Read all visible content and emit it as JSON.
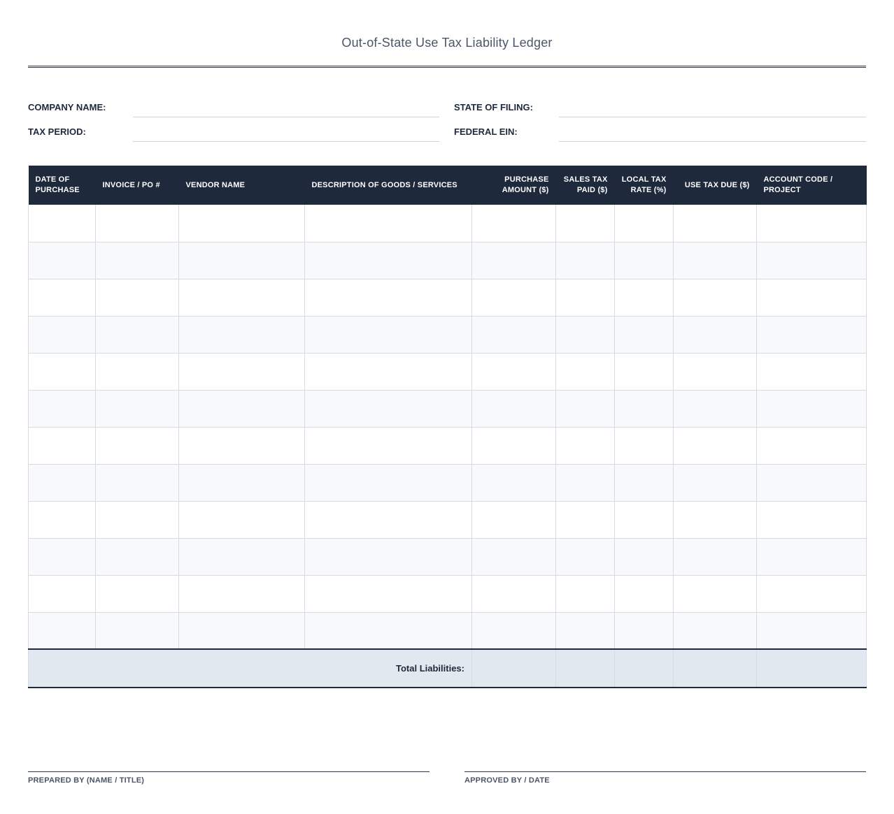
{
  "title": "Out-of-State Use Tax Liability Ledger",
  "fields": {
    "company_name": {
      "label": "COMPANY NAME:",
      "value": ""
    },
    "state_of_filing": {
      "label": "STATE OF FILING:",
      "value": ""
    },
    "tax_period": {
      "label": "TAX PERIOD:",
      "value": ""
    },
    "federal_ein": {
      "label": "FEDERAL EIN:",
      "value": ""
    }
  },
  "table": {
    "columns": [
      {
        "line1": "DATE OF",
        "line2": "PURCHASE"
      },
      {
        "line1": "INVOICE / PO #",
        "line2": ""
      },
      {
        "line1": "VENDOR NAME",
        "line2": ""
      },
      {
        "line1": "DESCRIPTION OF GOODS / SERVICES",
        "line2": ""
      },
      {
        "line1": "PURCHASE",
        "line2": "AMOUNT ($)"
      },
      {
        "line1": "SALES TAX",
        "line2": "PAID ($)"
      },
      {
        "line1": "LOCAL TAX",
        "line2": "RATE (%)"
      },
      {
        "line1": "USE TAX DUE ($)",
        "line2": ""
      },
      {
        "line1": "ACCOUNT CODE /",
        "line2": "PROJECT"
      }
    ],
    "rows": [
      [
        "",
        "",
        "",
        "",
        "",
        "",
        "",
        "",
        ""
      ],
      [
        "",
        "",
        "",
        "",
        "",
        "",
        "",
        "",
        ""
      ],
      [
        "",
        "",
        "",
        "",
        "",
        "",
        "",
        "",
        ""
      ],
      [
        "",
        "",
        "",
        "",
        "",
        "",
        "",
        "",
        ""
      ],
      [
        "",
        "",
        "",
        "",
        "",
        "",
        "",
        "",
        ""
      ],
      [
        "",
        "",
        "",
        "",
        "",
        "",
        "",
        "",
        ""
      ],
      [
        "",
        "",
        "",
        "",
        "",
        "",
        "",
        "",
        ""
      ],
      [
        "",
        "",
        "",
        "",
        "",
        "",
        "",
        "",
        ""
      ],
      [
        "",
        "",
        "",
        "",
        "",
        "",
        "",
        "",
        ""
      ],
      [
        "",
        "",
        "",
        "",
        "",
        "",
        "",
        "",
        ""
      ],
      [
        "",
        "",
        "",
        "",
        "",
        "",
        "",
        "",
        ""
      ],
      [
        "",
        "",
        "",
        "",
        "",
        "",
        "",
        "",
        ""
      ]
    ],
    "total_label": "Total Liabilities:",
    "totals": {
      "purchase_amount": "",
      "sales_tax_paid": "",
      "local_tax_rate": "",
      "use_tax_due": "",
      "account_code": ""
    }
  },
  "signatures": {
    "prepared_by": "PREPARED BY (NAME / TITLE)",
    "approved_by": "APPROVED BY / DATE"
  },
  "colors": {
    "header_bg": "#1e293b",
    "total_bg": "#e2e8f0",
    "alt_row_bg": "#f7f9fb"
  }
}
